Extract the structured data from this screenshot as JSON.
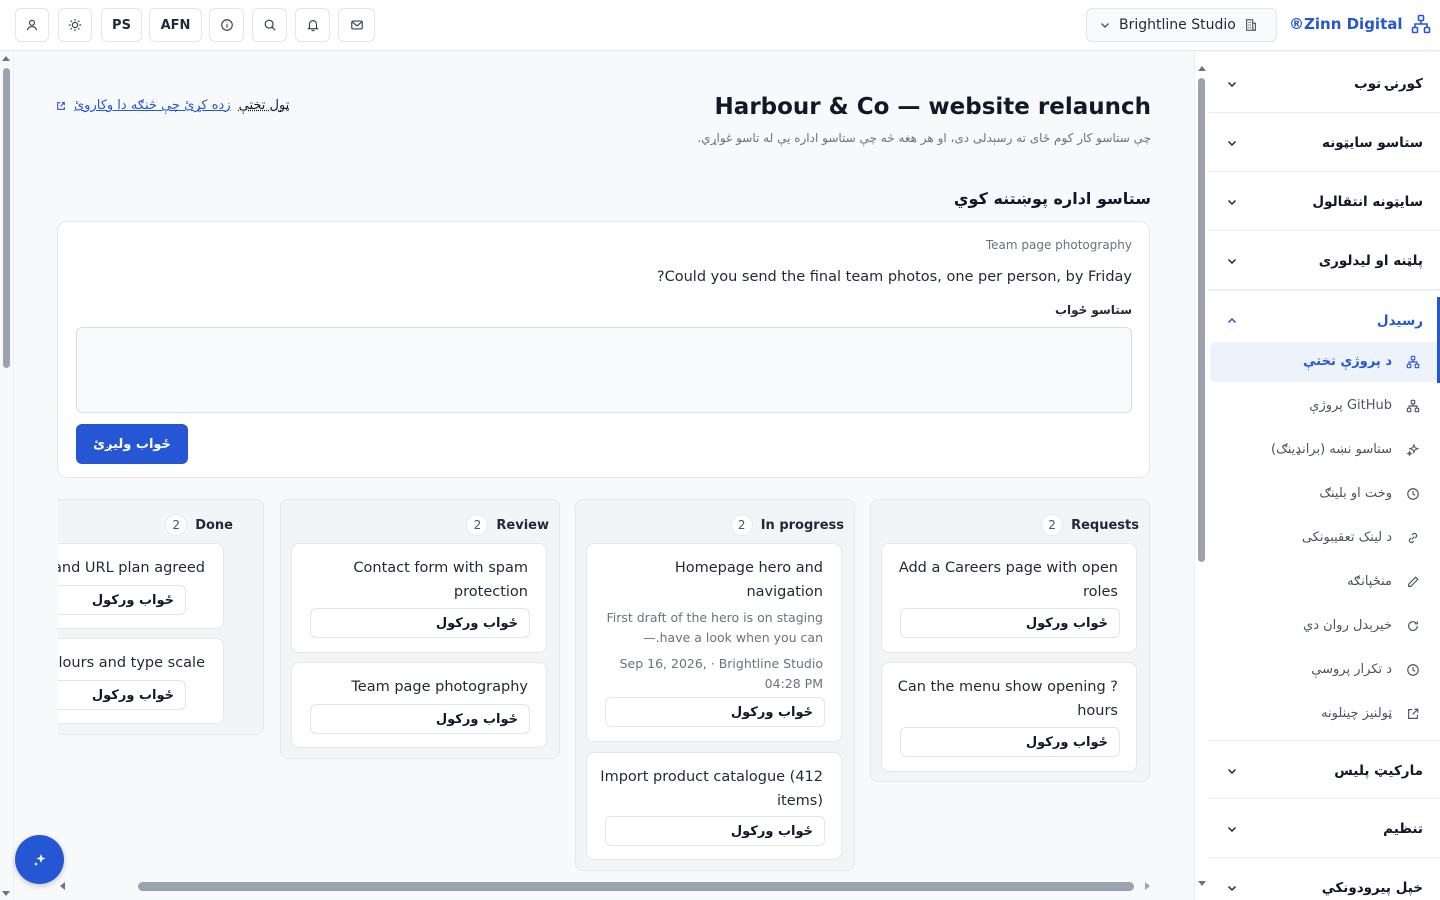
{
  "topbar": {
    "buttons": {
      "lang_ps": "PS",
      "currency": "AFN"
    },
    "studio": "Brightline Studio",
    "brand": "®Zinn Digital"
  },
  "page": {
    "title": "Harbour & Co — website relaunch",
    "description": "چې ستاسو کار کوم ځای ته رسېدلی دی، او هر هغه څه چې ستاسو اداره یې له تاسو غواړي.",
    "crumb": "ټول تختې",
    "back_link": "زده کړئ چې څنګه دا وکاروئ",
    "section_title": "ستاسو اداره پوښتنه کوي"
  },
  "reply": {
    "subject": "Team page photography",
    "question": "?Could you send the final team photos, one per person, by Friday",
    "label": "ستاسو ځواب",
    "send": "ځواب ولیږئ"
  },
  "board": {
    "work_label": "ځواب ورکول",
    "columns": [
      {
        "name": "Requests",
        "count": "2",
        "cards": [
          {
            "title": "Add a Careers page with open roles"
          },
          {
            "title": "Can the menu show opening ?hours"
          }
        ]
      },
      {
        "name": "In progress",
        "count": "2",
        "cards": [
          {
            "title": "Homepage hero and navigation",
            "desc": "First draft of the hero is on staging —.have a look when you can",
            "meta": "Sep 16, 2026, · Brightline Studio 04:28 PM"
          },
          {
            "title": "Import product catalogue (412 items)"
          }
        ]
      },
      {
        "name": "Review",
        "count": "2",
        "cards": [
          {
            "title": "Contact form with spam protection"
          },
          {
            "title": "Team page photography"
          }
        ]
      },
      {
        "name": "Done",
        "count": "2",
        "cards": [
          {
            "title": "Sitemap and URL plan agreed"
          },
          {
            "title": "Brand colours and type scale"
          }
        ]
      }
    ]
  },
  "sidebar": {
    "sections": [
      {
        "label": "کورنۍ توب"
      },
      {
        "label": "ستاسو سایټونه"
      },
      {
        "label": "سایټونه انتقالول"
      },
      {
        "label": "پلټنه او لیدلوری"
      },
      {
        "label": "رسیدل"
      },
      {
        "label": "ماركيټ پلیس"
      },
      {
        "label": "تنظیم"
      },
      {
        "label": "خپل پیرودونکي"
      }
    ],
    "sub_items": [
      {
        "label": "د پروژې تختې",
        "icon": "project-icon"
      },
      {
        "label": "GitHub پروژې",
        "icon": "github-project-icon"
      },
      {
        "label": "ستاسو نښه (برانډینګ)",
        "icon": "sparkle-icon"
      },
      {
        "label": "وخت او بلینګ",
        "icon": "clock-icon"
      },
      {
        "label": "د لینک تعقیبونکی",
        "icon": "link-icon"
      },
      {
        "label": "منځپانګه",
        "icon": "pencil-icon"
      },
      {
        "label": "خیرېدل روان دي",
        "icon": "refresh-icon"
      },
      {
        "label": "د تکرار پروسې",
        "icon": "history-icon"
      },
      {
        "label": "ټولنیز چینلونه",
        "icon": "external-link-icon"
      }
    ]
  }
}
